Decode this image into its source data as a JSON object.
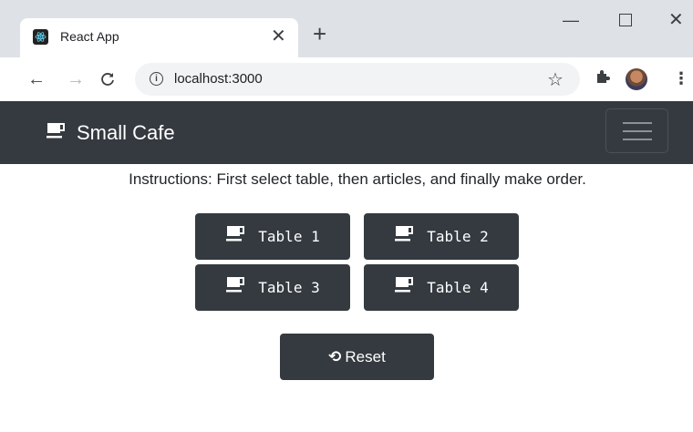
{
  "browser": {
    "tab_title": "React App",
    "tab_close": "✕",
    "new_tab": "+",
    "window": {
      "minimize": "—",
      "close": "✕"
    },
    "nav": {
      "back": "←",
      "forward": "→",
      "reload": "C"
    },
    "url": "localhost:3000",
    "icons": {
      "bookmark": "☆",
      "extensions": "✱",
      "menu": "⋮",
      "info": "i"
    }
  },
  "navbar": {
    "brand": "Small Cafe"
  },
  "instructions": "Instructions: First select table, then articles, and finally make order.",
  "tables": [
    {
      "label": "Table 1"
    },
    {
      "label": "Table 2"
    },
    {
      "label": "Table 3"
    },
    {
      "label": "Table 4"
    }
  ],
  "reset": {
    "icon": "⟲",
    "label": "Reset"
  },
  "colors": {
    "navbar": "#343a40",
    "button": "#343a40",
    "tabstrip": "#dee1e6"
  }
}
